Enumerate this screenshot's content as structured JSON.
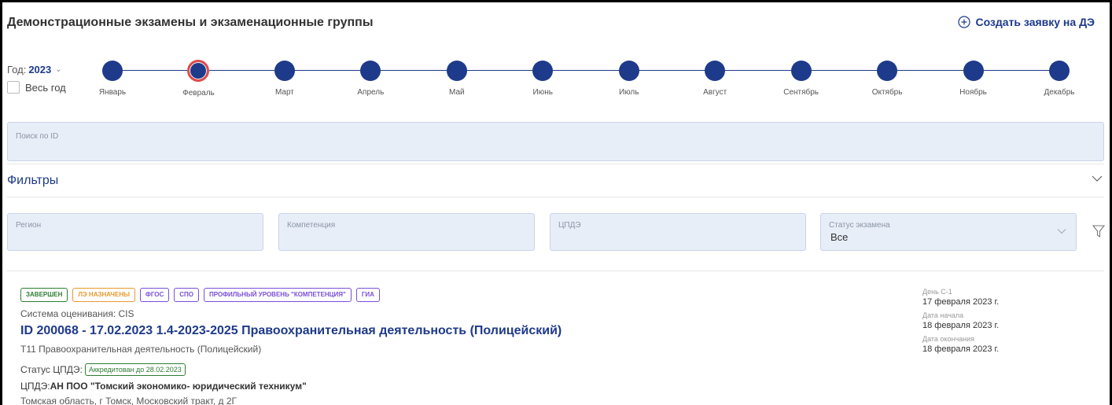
{
  "header": {
    "title": "Демонстрационные экзамены и экзаменационные группы",
    "create_label": "Создать заявку на ДЭ"
  },
  "year": {
    "label": "Год:",
    "value": "2023",
    "all_year_label": "Весь год"
  },
  "timeline": {
    "months": [
      "Январь",
      "Февраль",
      "Март",
      "Апрель",
      "Май",
      "Июнь",
      "Июль",
      "Август",
      "Сентябрь",
      "Октябрь",
      "Ноябрь",
      "Декабрь"
    ],
    "selected": "Февраль",
    "dot_color": "#1e3a8a",
    "selected_ring_color": "#e04b4b"
  },
  "search": {
    "placeholder": "Поиск по ID"
  },
  "filters": {
    "title": "Фильтры",
    "region": {
      "label": "Регион"
    },
    "competence": {
      "label": "Компетенция"
    },
    "cpde": {
      "label": "ЦПДЭ"
    },
    "exam_status": {
      "label": "Статус экзамена",
      "value": "Все"
    }
  },
  "exam": {
    "badges": [
      {
        "text": "ЗАВЕРШЕН",
        "color": "#2e7d32"
      },
      {
        "text": "ЛЭ НАЗНАЧЕНЫ",
        "color": "#e69a2e"
      },
      {
        "text": "ФГОС",
        "color": "#7a4fd8"
      },
      {
        "text": "СПО",
        "color": "#7a4fd8"
      },
      {
        "text": "ПРОФИЛЬНЫЙ УРОВЕНЬ \"КОМПЕТЕНЦИЯ\"",
        "color": "#7a4fd8"
      },
      {
        "text": "ГИА",
        "color": "#7a4fd8"
      }
    ],
    "grading_system": "Система оценивания: CIS",
    "title": "ID 200068 - 17.02.2023 1.4-2023-2025 Правоохранительная деятельность (Полицейский)",
    "competence": "Т11  Правоохранительная деятельность (Полицейский)",
    "cpde_status_label": "Статус ЦПДЭ:",
    "cpde_status_badge": "Аккредитован до 28.02.2023",
    "cpde_label": "ЦПДЭ:",
    "cpde_name": "АН ПОО \"Томский экономико- юридический техникум\"",
    "address": "Томская область, г Томск, Московский тракт, д 2Г",
    "dates": [
      {
        "label": "День С-1",
        "value": "17 февраля 2023 г."
      },
      {
        "label": "Дата начала",
        "value": "18 февраля 2023 г."
      },
      {
        "label": "Дата окончания",
        "value": "18 февраля 2023 г."
      }
    ]
  }
}
